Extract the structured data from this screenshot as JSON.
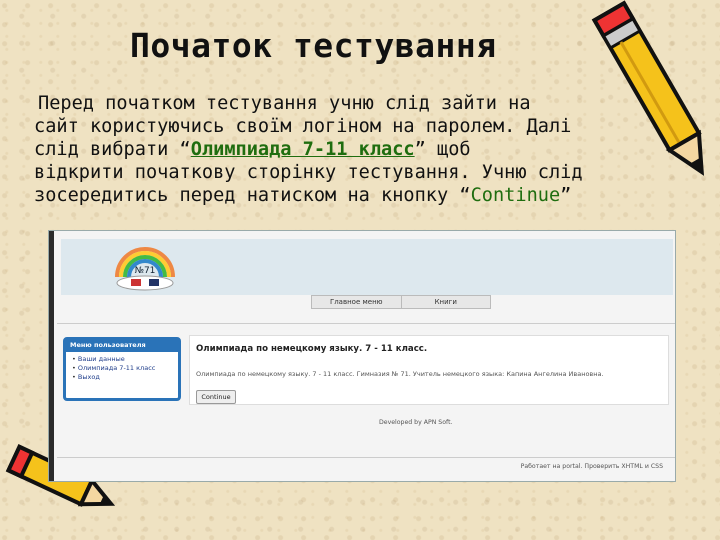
{
  "slide": {
    "title": "Початок тестування",
    "body": {
      "line1": "Перед початком тестування учню слід зайти на",
      "line2": "сайт користуючись своїм логіном на паролем. Далі",
      "line3_prefix": "слід вибрати “",
      "line3_highlight": "Олимпиада 7-11 класс",
      "line3_suffix": "” щоб",
      "line4": "відкрити початкову сторінку тестування. Учню слід",
      "line5_prefix": "зосередитись перед натиском на кнопку “",
      "line5_highlight": "Continue",
      "line5_suffix": "”"
    }
  },
  "screenshot": {
    "logo": {
      "text": "№71"
    },
    "nav": {
      "home": "Главное меню",
      "books": "Книги"
    },
    "user_menu": {
      "title": "Меню пользователя",
      "items": [
        "Ваши данные",
        "Олимпиада 7-11 класс",
        "Выход"
      ]
    },
    "content": {
      "title": "Олимпиада по немецкому языку. 7 - 11 класс.",
      "description": "Олимпиада по немецкому языку. 7 - 11 класс. Гимназия № 71. Учитель немецкого языка: Капина Ангелина Ивановна.",
      "continue_label": "Continue"
    },
    "developed_by": "Developed by APN Soft.",
    "footer": "Работает на portal. Проверить XHTML и CSS"
  },
  "colors": {
    "background": "#efe2c2",
    "menu_blue": "#2a73b8",
    "highlight_green": "#1f6d0f"
  }
}
